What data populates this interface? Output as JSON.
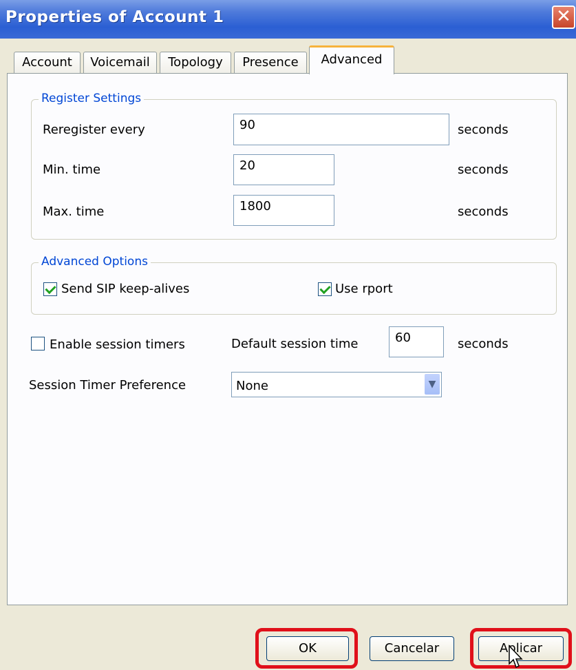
{
  "window": {
    "title": "Properties of Account 1",
    "close": "✕"
  },
  "tabs": [
    {
      "label": "Account"
    },
    {
      "label": "Voicemail"
    },
    {
      "label": "Topology"
    },
    {
      "label": "Presence"
    },
    {
      "label": "Advanced"
    }
  ],
  "register": {
    "legend": "Register Settings",
    "reregister_label": "Reregister every",
    "reregister_value": "90",
    "min_label": "Min. time",
    "min_value": "20",
    "max_label": "Max. time",
    "max_value": "1800",
    "unit": "seconds"
  },
  "advanced_options": {
    "legend": "Advanced Options",
    "keepalive_label": "Send SIP keep-alives",
    "keepalive_checked": true,
    "rport_label": "Use rport",
    "rport_checked": true
  },
  "session": {
    "enable_label": "Enable session timers",
    "enable_checked": false,
    "default_time_label": "Default session time",
    "default_time_value": "60",
    "unit": "seconds",
    "pref_label": "Session Timer Preference",
    "pref_value": "None"
  },
  "buttons": {
    "ok": "OK",
    "cancel": "Cancelar",
    "apply": "Aplicar"
  },
  "highlight_color": "#e0101a"
}
